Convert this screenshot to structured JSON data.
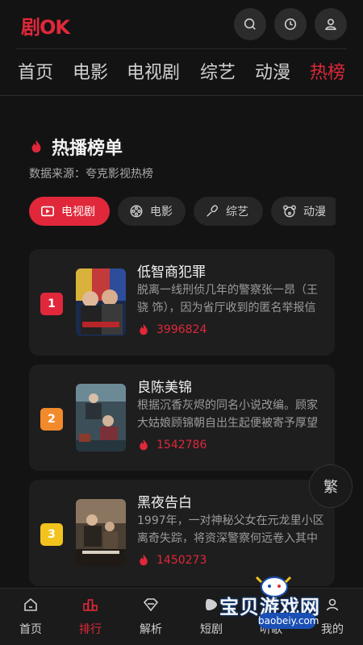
{
  "app": {
    "logo": "剧OK"
  },
  "header": {
    "icons": [
      "search-icon",
      "history-clock-icon",
      "user-icon"
    ]
  },
  "nav": {
    "tabs": [
      "首页",
      "电影",
      "电视剧",
      "综艺",
      "动漫",
      "热榜"
    ],
    "active": "热榜"
  },
  "section": {
    "title": "热播榜单",
    "source": "数据来源：夸克影视热榜"
  },
  "categories": [
    {
      "label": "电视剧",
      "icon": "tv-icon",
      "active": true
    },
    {
      "label": "电影",
      "icon": "film-reel-icon",
      "active": false
    },
    {
      "label": "综艺",
      "icon": "microphone-icon",
      "active": false
    },
    {
      "label": "动漫",
      "icon": "bear-icon",
      "active": false
    }
  ],
  "list": [
    {
      "rank": "1",
      "rank_color": "#e0283a",
      "title": "低智商犯罪",
      "desc": "脱离一线刑侦几年的警察张一昂（王骁 饰），因为省厅收到的匿名举报信",
      "hot": "3996824"
    },
    {
      "rank": "2",
      "rank_color": "#f28a2c",
      "title": "良陈美锦",
      "desc": "根据沉香灰烬的同名小说改编。顾家大姑娘顾锦朝自出生起便被寄予厚望",
      "hot": "1542786"
    },
    {
      "rank": "3",
      "rank_color": "#f2c31d",
      "title": "黑夜告白",
      "desc": "1997年，一对神秘父女在元龙里小区离奇失踪，将资深警察何远卷入其中",
      "hot": "1450273"
    }
  ],
  "float_button": {
    "label": "繁"
  },
  "bottom_nav": [
    {
      "label": "首页",
      "icon": "home-icon",
      "active": false
    },
    {
      "label": "排行",
      "icon": "ranking-icon",
      "active": true
    },
    {
      "label": "解析",
      "icon": "diamond-icon",
      "active": false
    },
    {
      "label": "短剧",
      "icon": "short-video-icon",
      "active": false
    },
    {
      "label": "听歌",
      "icon": "music-icon",
      "active": false
    },
    {
      "label": "我的",
      "icon": "profile-icon",
      "active": false
    }
  ],
  "watermark": {
    "text": "宝贝游戏网",
    "url": "baobeiy.com"
  }
}
